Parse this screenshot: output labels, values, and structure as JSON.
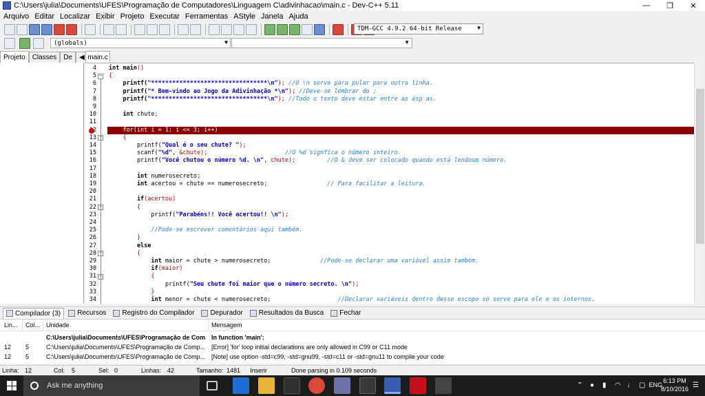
{
  "window": {
    "title": "C:\\Users\\julia\\Documents\\UFES\\Programação de Computadores\\Linguagem C\\adivinhacao\\main.c - Dev-C++ 5.11"
  },
  "menu": [
    "Arquivo",
    "Editar",
    "Localizar",
    "Exibir",
    "Projeto",
    "Executar",
    "Ferramentas",
    "AStyle",
    "Janela",
    "Ajuda"
  ],
  "toolbar": {
    "compiler": "TDM-GCC 4.9.2 64-bit Release",
    "scope": "(globals)"
  },
  "left_tabs": [
    "Projeto",
    "Classes",
    "De"
  ],
  "file_tab": "main.c",
  "editor": {
    "lines": [
      {
        "n": "4",
        "fold": "",
        "parts": [
          {
            "t": "int ",
            "c": "kw"
          },
          {
            "t": "main",
            "c": "kw"
          },
          {
            "t": "()",
            "c": "sym"
          }
        ]
      },
      {
        "n": "5",
        "fold": "minus",
        "parts": [
          {
            "t": "{",
            "c": "sym"
          }
        ]
      },
      {
        "n": "6",
        "fold": "",
        "parts": [
          {
            "t": "    printf(",
            "c": "kw"
          },
          {
            "t": "\"*********************************\\n\"",
            "c": "str"
          },
          {
            "t": ");",
            "c": "sym"
          },
          {
            "t": " //O \\n serve para pular para outra linha.",
            "c": "cmt"
          }
        ]
      },
      {
        "n": "7",
        "fold": "",
        "parts": [
          {
            "t": "    printf(",
            "c": "kw"
          },
          {
            "t": "\"* Bem-vindo ao Jogo da Adivinhação *\\n\"",
            "c": "str"
          },
          {
            "t": ");",
            "c": "sym"
          },
          {
            "t": " //Deve-se lembrar do ;",
            "c": "cmt"
          }
        ]
      },
      {
        "n": "8",
        "fold": "",
        "parts": [
          {
            "t": "    printf(",
            "c": "kw"
          },
          {
            "t": "\"*********************************\\n\"",
            "c": "str"
          },
          {
            "t": ");",
            "c": "sym"
          },
          {
            "t": " //Todo o texto deve estar entre as ásp as.",
            "c": "cmt"
          }
        ]
      },
      {
        "n": "9",
        "fold": "",
        "parts": []
      },
      {
        "n": "10",
        "fold": "",
        "parts": [
          {
            "t": "    int ",
            "c": "kw"
          },
          {
            "t": "chute",
            "c": ""
          },
          {
            "t": ";",
            "c": "sym"
          }
        ]
      },
      {
        "n": "11",
        "fold": "",
        "parts": []
      },
      {
        "n": "12",
        "fold": "err",
        "parts": [
          {
            "t": "    for(int i = 1; i <= 3; i++)",
            "c": ""
          }
        ]
      },
      {
        "n": "13",
        "fold": "minus",
        "parts": [
          {
            "t": "    {",
            "c": "sym"
          }
        ]
      },
      {
        "n": "14",
        "fold": "",
        "parts": [
          {
            "t": "        printf(",
            "c": ""
          },
          {
            "t": "\"Qual é o seu chute? \"",
            "c": "str"
          },
          {
            "t": ");",
            "c": "sym"
          }
        ]
      },
      {
        "n": "15",
        "fold": "",
        "parts": [
          {
            "t": "        scanf(",
            "c": ""
          },
          {
            "t": "\"%d\"",
            "c": "str"
          },
          {
            "t": ", &chute);",
            "c": "sym"
          },
          {
            "t": "                      //O %d signfica o número inteiro.",
            "c": "cmt"
          }
        ]
      },
      {
        "n": "16",
        "fold": "",
        "parts": [
          {
            "t": "        printf(",
            "c": ""
          },
          {
            "t": "\"Você chutou o número %d. \\n\"",
            "c": "str"
          },
          {
            "t": ", chute);",
            "c": "sym"
          },
          {
            "t": "         //O & deve ser colocado quando está lendoum número.",
            "c": "cmt"
          }
        ]
      },
      {
        "n": "17",
        "fold": "",
        "parts": []
      },
      {
        "n": "18",
        "fold": "",
        "parts": [
          {
            "t": "        int ",
            "c": "kw"
          },
          {
            "t": "numerosecreto",
            "c": ""
          },
          {
            "t": ";",
            "c": "sym"
          }
        ]
      },
      {
        "n": "19",
        "fold": "",
        "parts": [
          {
            "t": "        int ",
            "c": "kw"
          },
          {
            "t": "acertou = chute == numerosecreto",
            "c": ""
          },
          {
            "t": ";",
            "c": "sym"
          },
          {
            "t": "                 // Para facilitar a leitura.",
            "c": "cmt"
          }
        ]
      },
      {
        "n": "20",
        "fold": "",
        "parts": []
      },
      {
        "n": "21",
        "fold": "",
        "parts": [
          {
            "t": "        if",
            "c": "kw"
          },
          {
            "t": "(acertou)",
            "c": "sym"
          }
        ]
      },
      {
        "n": "22",
        "fold": "minus",
        "parts": [
          {
            "t": "        {",
            "c": "sym"
          }
        ]
      },
      {
        "n": "23",
        "fold": "",
        "parts": [
          {
            "t": "            printf(",
            "c": ""
          },
          {
            "t": "\"Parabéns!! Você acertou!! \\n\"",
            "c": "str"
          },
          {
            "t": ");",
            "c": "sym"
          }
        ]
      },
      {
        "n": "24",
        "fold": "",
        "parts": []
      },
      {
        "n": "25",
        "fold": "",
        "parts": [
          {
            "t": "            //Pode-se escrever comentários aqui também.",
            "c": "cmt"
          }
        ]
      },
      {
        "n": "26",
        "fold": "",
        "parts": [
          {
            "t": "        }",
            "c": "sym"
          }
        ]
      },
      {
        "n": "27",
        "fold": "",
        "parts": [
          {
            "t": "        else",
            "c": "kw"
          }
        ]
      },
      {
        "n": "28",
        "fold": "minus",
        "parts": [
          {
            "t": "        {",
            "c": "sym"
          }
        ]
      },
      {
        "n": "29",
        "fold": "",
        "parts": [
          {
            "t": "            int ",
            "c": "kw"
          },
          {
            "t": "maior = chute > numerosecreto",
            "c": ""
          },
          {
            "t": ";",
            "c": "sym"
          },
          {
            "t": "              //Pode-se declarar uma variável assim também.",
            "c": "cmt"
          }
        ]
      },
      {
        "n": "30",
        "fold": "",
        "parts": [
          {
            "t": "            if",
            "c": "kw"
          },
          {
            "t": "(maior)",
            "c": "sym"
          }
        ]
      },
      {
        "n": "31",
        "fold": "minus",
        "parts": [
          {
            "t": "            {",
            "c": "sym"
          }
        ]
      },
      {
        "n": "32",
        "fold": "",
        "parts": [
          {
            "t": "                printf(",
            "c": ""
          },
          {
            "t": "\"Seu chute foi maior que o número secreto. \\n\"",
            "c": "str"
          },
          {
            "t": ");",
            "c": "sym"
          }
        ]
      },
      {
        "n": "33",
        "fold": "",
        "parts": [
          {
            "t": "            }",
            "c": "sym"
          }
        ]
      },
      {
        "n": "34",
        "fold": "",
        "parts": [
          {
            "t": "            int ",
            "c": "kw"
          },
          {
            "t": "menor = chute < numerosecreto",
            "c": ""
          },
          {
            "t": ";",
            "c": "sym"
          },
          {
            "t": "                   //Declarar variáveis dentro desse escopo só serve para ele e os internos.",
            "c": "cmt"
          }
        ]
      }
    ]
  },
  "bottom_tabs": [
    "Compilador (3)",
    "Recursos",
    "Registro do Compilador",
    "Depurador",
    "Resultados da Busca",
    "Fechar"
  ],
  "messages": {
    "headers": [
      "Lin...",
      "Col...",
      "Unidade",
      "Mensagem"
    ],
    "rows": [
      {
        "line": "",
        "col": "",
        "unit": "C:\\Users\\julia\\Documents\\UFES\\Programação de Com...",
        "msg": "In function 'main':",
        "bold": true
      },
      {
        "line": "12",
        "col": "5",
        "unit": "C:\\Users\\julia\\Documents\\UFES\\Programação de Comp...",
        "msg": "[Error] 'for' loop initial declarations are only allowed in C99 or C11 mode",
        "bold": false
      },
      {
        "line": "12",
        "col": "5",
        "unit": "C:\\Users\\julia\\Documents\\UFES\\Programação de Comp...",
        "msg": "[Note] use option -std=c99, -std=gnu99, -std=c11 or -std=gnu11 to compile your code",
        "bold": false
      }
    ]
  },
  "status": {
    "linha_l": "Linha:",
    "linha": "12",
    "col_l": "Col:",
    "col": "5",
    "sel_l": "Sel:",
    "sel": "0",
    "linhas_l": "Linhas:",
    "linhas": "42",
    "tam_l": "Tamanho:",
    "tam": "1481",
    "mode": "Inserir",
    "msg": "Done parsing in 0.109 seconds"
  },
  "taskbar": {
    "search": "Ask me anything",
    "time": "6:13 PM",
    "date": "8/10/2016",
    "lang": "ENG"
  }
}
